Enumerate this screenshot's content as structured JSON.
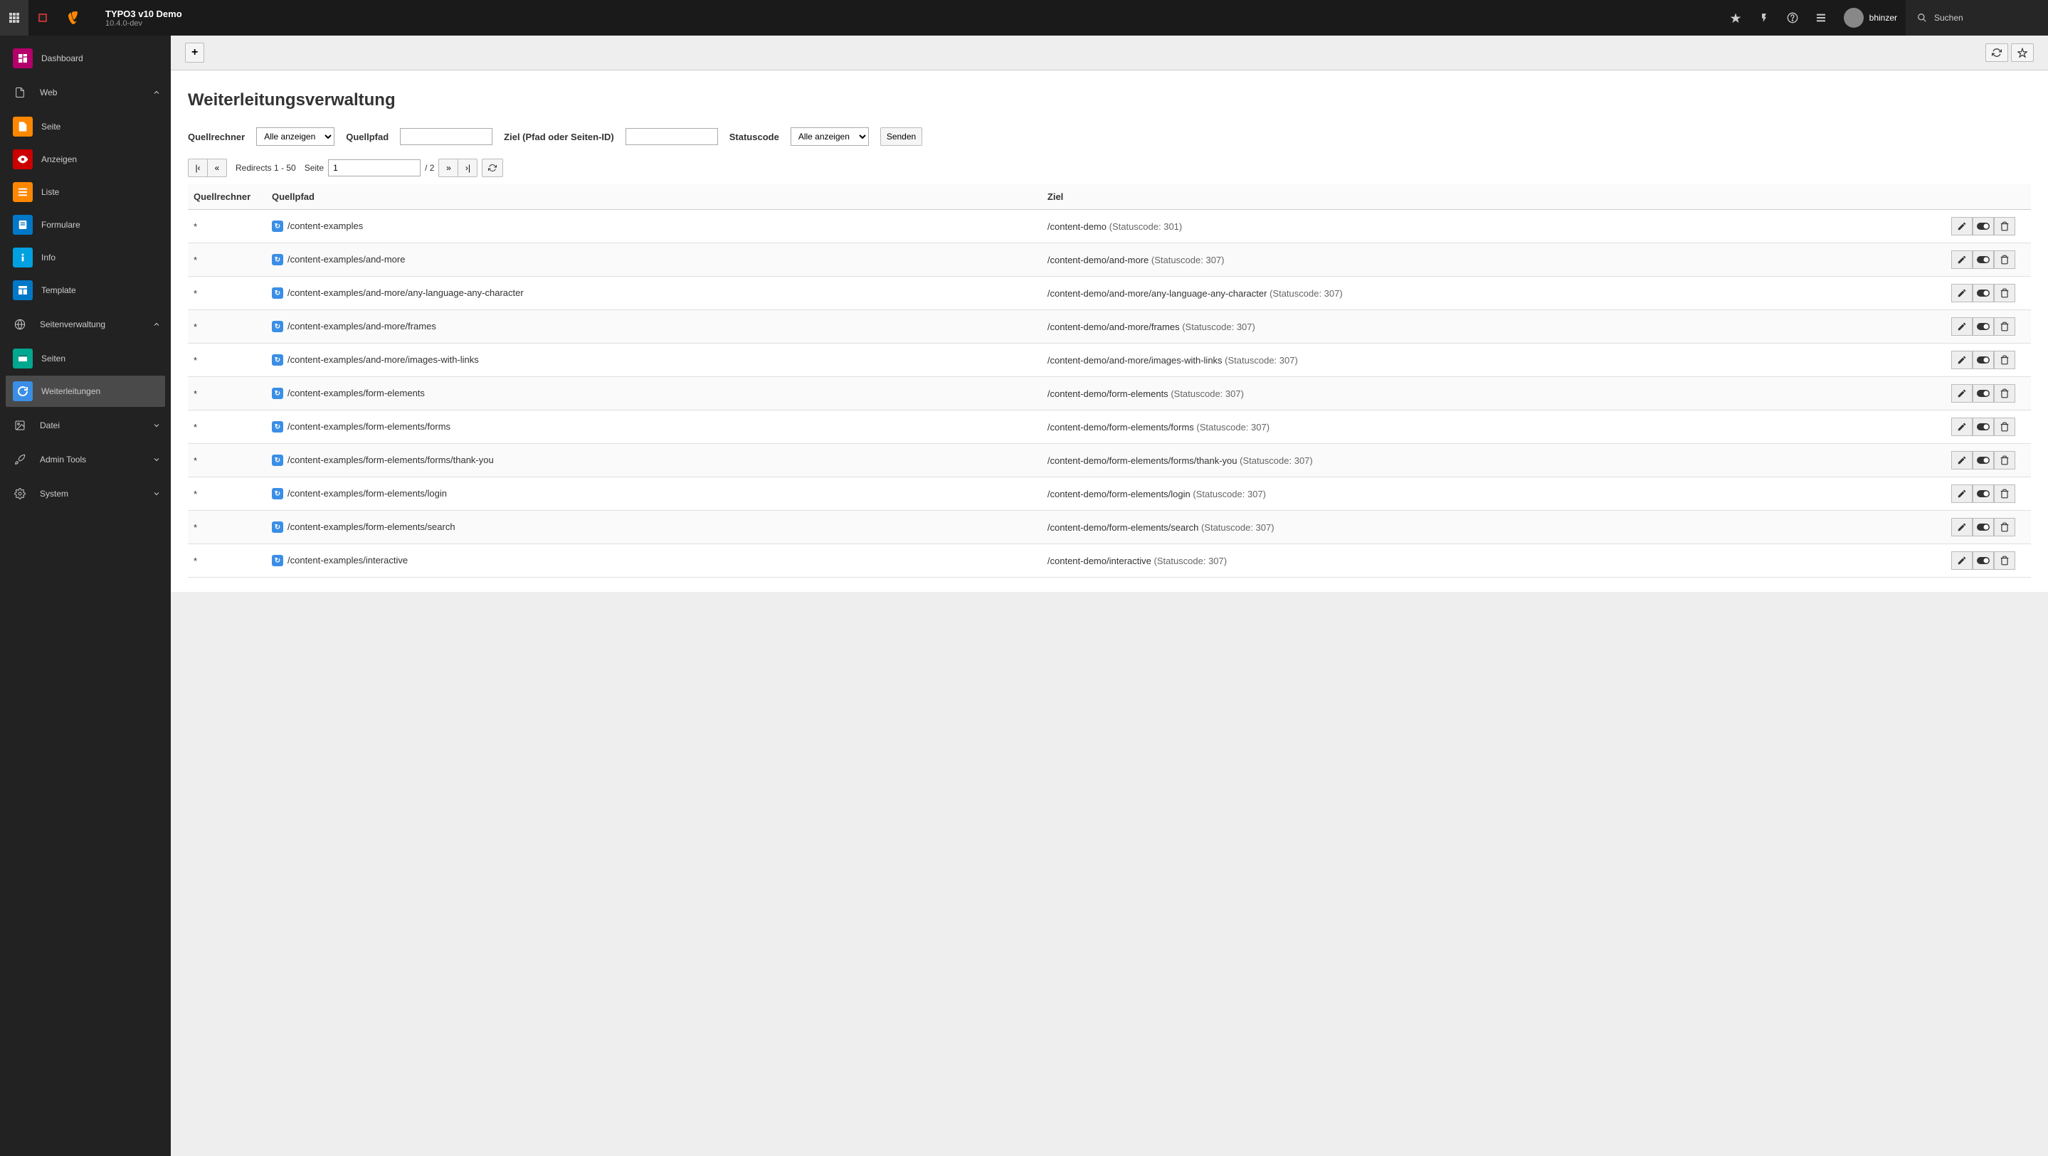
{
  "topbar": {
    "site_title": "TYPO3 v10 Demo",
    "version": "10.4.0-dev",
    "username": "bhinzer",
    "search_placeholder": "Suchen"
  },
  "sidebar": {
    "dashboard": "Dashboard",
    "groups": {
      "web": {
        "label": "Web",
        "expanded": true,
        "items": [
          {
            "key": "page",
            "label": "Seite",
            "color": "#ff8700"
          },
          {
            "key": "view",
            "label": "Anzeigen",
            "color": "#cc0000"
          },
          {
            "key": "list",
            "label": "Liste",
            "color": "#ff8700"
          },
          {
            "key": "forms",
            "label": "Formulare",
            "color": "#0078c8"
          },
          {
            "key": "info",
            "label": "Info",
            "color": "#00a0e1"
          },
          {
            "key": "template",
            "label": "Template",
            "color": "#0078c8"
          }
        ]
      },
      "site": {
        "label": "Seitenverwaltung",
        "expanded": true,
        "items": [
          {
            "key": "sites",
            "label": "Seiten",
            "color": "#00a88f"
          },
          {
            "key": "redirects",
            "label": "Weiterleitungen",
            "color": "#3a8ee6",
            "active": true
          }
        ]
      },
      "file": {
        "label": "Datei",
        "expanded": false
      },
      "admin": {
        "label": "Admin Tools",
        "expanded": false
      },
      "system": {
        "label": "System",
        "expanded": false
      }
    }
  },
  "page": {
    "title": "Weiterleitungsverwaltung",
    "filters": {
      "host_label": "Quellrechner",
      "host_value": "Alle anzeigen",
      "path_label": "Quellpfad",
      "path_value": "",
      "target_label": "Ziel (Pfad oder Seiten-ID)",
      "target_value": "",
      "status_label": "Statuscode",
      "status_value": "Alle anzeigen",
      "submit": "Senden"
    },
    "pagination": {
      "range": "Redirects 1 - 50",
      "page_label": "Seite",
      "page": "1",
      "total": "/ 2"
    },
    "columns": {
      "host": "Quellrechner",
      "path": "Quellpfad",
      "target": "Ziel"
    },
    "status_prefix": "(Statuscode: ",
    "status_suffix": ")",
    "rows": [
      {
        "host": "*",
        "path": "/content-examples",
        "target": "/content-demo",
        "code": "301"
      },
      {
        "host": "*",
        "path": "/content-examples/and-more",
        "target": "/content-demo/and-more",
        "code": "307"
      },
      {
        "host": "*",
        "path": "/content-examples/and-more/any-language-any-character",
        "target": "/content-demo/and-more/any-language-any-character",
        "code": "307"
      },
      {
        "host": "*",
        "path": "/content-examples/and-more/frames",
        "target": "/content-demo/and-more/frames",
        "code": "307"
      },
      {
        "host": "*",
        "path": "/content-examples/and-more/images-with-links",
        "target": "/content-demo/and-more/images-with-links",
        "code": "307"
      },
      {
        "host": "*",
        "path": "/content-examples/form-elements",
        "target": "/content-demo/form-elements",
        "code": "307"
      },
      {
        "host": "*",
        "path": "/content-examples/form-elements/forms",
        "target": "/content-demo/form-elements/forms",
        "code": "307"
      },
      {
        "host": "*",
        "path": "/content-examples/form-elements/forms/thank-you",
        "target": "/content-demo/form-elements/forms/thank-you",
        "code": "307"
      },
      {
        "host": "*",
        "path": "/content-examples/form-elements/login",
        "target": "/content-demo/form-elements/login",
        "code": "307"
      },
      {
        "host": "*",
        "path": "/content-examples/form-elements/search",
        "target": "/content-demo/form-elements/search",
        "code": "307"
      },
      {
        "host": "*",
        "path": "/content-examples/interactive",
        "target": "/content-demo/interactive",
        "code": "307"
      }
    ]
  }
}
